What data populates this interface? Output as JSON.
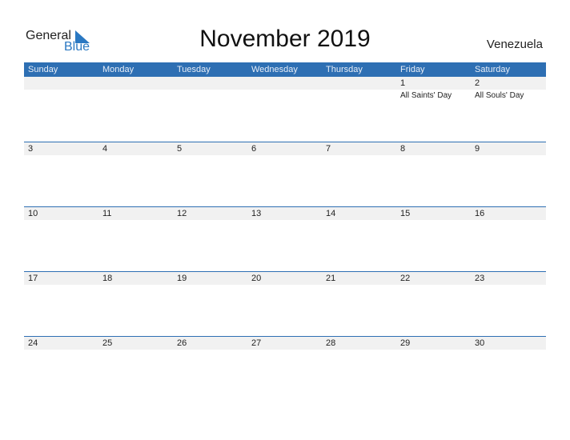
{
  "brand": {
    "general": "General",
    "blue": "Blue"
  },
  "title": "November 2019",
  "country": "Venezuela",
  "colors": {
    "accent": "#2e6fb3",
    "band": "#f1f1f1",
    "logo_blue": "#2a78c2"
  },
  "days": [
    "Sunday",
    "Monday",
    "Tuesday",
    "Wednesday",
    "Thursday",
    "Friday",
    "Saturday"
  ],
  "weeks": [
    [
      {
        "d": ""
      },
      {
        "d": ""
      },
      {
        "d": ""
      },
      {
        "d": ""
      },
      {
        "d": ""
      },
      {
        "d": "1",
        "h": "All Saints' Day"
      },
      {
        "d": "2",
        "h": "All Souls' Day"
      }
    ],
    [
      {
        "d": "3"
      },
      {
        "d": "4"
      },
      {
        "d": "5"
      },
      {
        "d": "6"
      },
      {
        "d": "7"
      },
      {
        "d": "8"
      },
      {
        "d": "9"
      }
    ],
    [
      {
        "d": "10"
      },
      {
        "d": "11"
      },
      {
        "d": "12"
      },
      {
        "d": "13"
      },
      {
        "d": "14"
      },
      {
        "d": "15"
      },
      {
        "d": "16"
      }
    ],
    [
      {
        "d": "17"
      },
      {
        "d": "18"
      },
      {
        "d": "19"
      },
      {
        "d": "20"
      },
      {
        "d": "21"
      },
      {
        "d": "22"
      },
      {
        "d": "23"
      }
    ],
    [
      {
        "d": "24"
      },
      {
        "d": "25"
      },
      {
        "d": "26"
      },
      {
        "d": "27"
      },
      {
        "d": "28"
      },
      {
        "d": "29"
      },
      {
        "d": "30"
      }
    ]
  ]
}
